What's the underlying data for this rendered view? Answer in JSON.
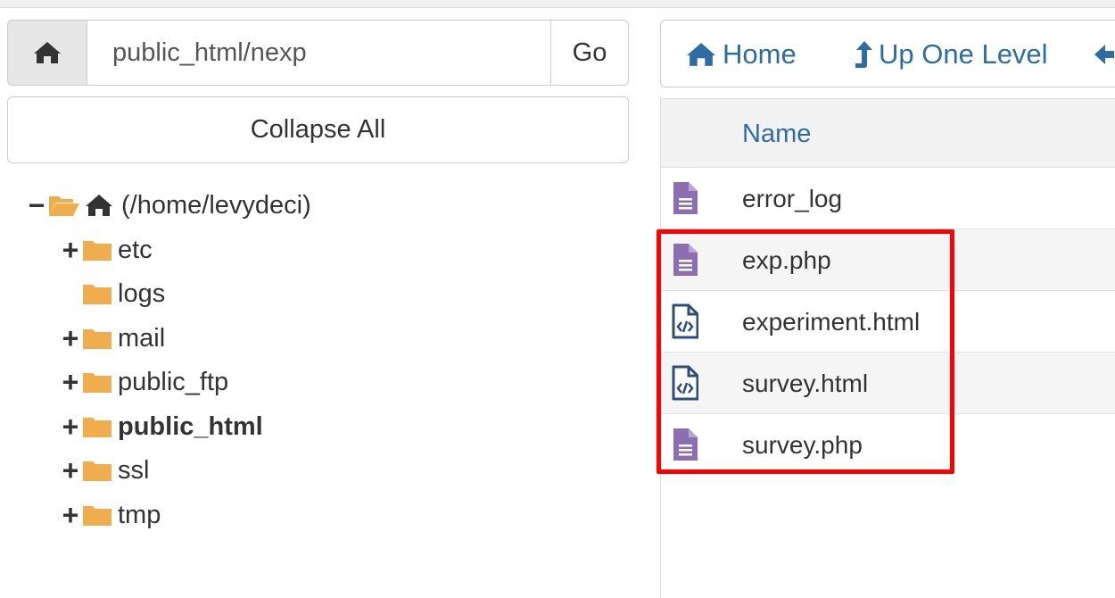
{
  "path_bar": {
    "path_value": "public_html/nexp",
    "go_label": "Go"
  },
  "tree_controls": {
    "collapse_label": "Collapse All"
  },
  "tree": {
    "root": {
      "toggle": "−",
      "label": "(/home/levydeci)"
    },
    "items": [
      {
        "toggle": "+",
        "label": "etc"
      },
      {
        "toggle": "",
        "label": "logs"
      },
      {
        "toggle": "+",
        "label": "mail"
      },
      {
        "toggle": "+",
        "label": "public_ftp"
      },
      {
        "toggle": "+",
        "label": "public_html"
      },
      {
        "toggle": "+",
        "label": "ssl"
      },
      {
        "toggle": "+",
        "label": "tmp"
      }
    ]
  },
  "toolbar": {
    "home_label": "Home",
    "up_label": "Up One Level"
  },
  "file_table": {
    "name_header": "Name",
    "rows": [
      {
        "name": "error_log",
        "icon": "text-file-icon"
      },
      {
        "name": "exp.php",
        "icon": "text-file-icon"
      },
      {
        "name": "experiment.html",
        "icon": "code-file-icon"
      },
      {
        "name": "survey.html",
        "icon": "code-file-icon"
      },
      {
        "name": "survey.php",
        "icon": "text-file-icon"
      }
    ]
  },
  "colors": {
    "link_blue": "#2e6da4",
    "folder_orange": "#f0ad4e",
    "file_purple": "#8c6fb0",
    "code_file_blue": "#2c4f7a",
    "highlight_red": "#ff0000"
  }
}
